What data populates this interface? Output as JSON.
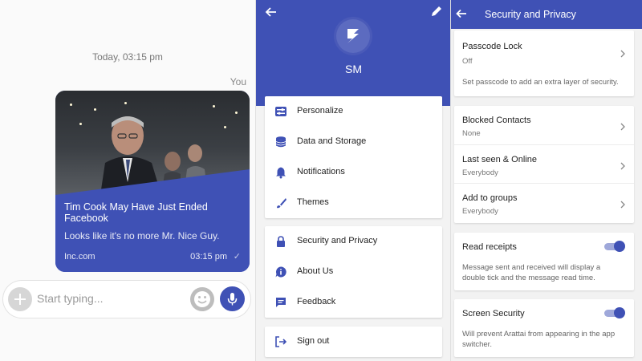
{
  "colors": {
    "accent": "#3f51b5"
  },
  "chat": {
    "date_label": "Today, 03:15 pm",
    "sender_label": "You",
    "link_card": {
      "title": "Tim Cook May Have Just Ended Facebook",
      "subtitle": "Looks like it's no more Mr. Nice Guy.",
      "source": "Inc.com",
      "time": "03:15 pm",
      "status_icon": "check-icon"
    },
    "composer": {
      "placeholder": "Start typing...",
      "add_icon": "plus-icon",
      "emoji_icon": "emoji-icon",
      "mic_icon": "mic-icon"
    }
  },
  "menu": {
    "profile_name": "SM",
    "header_icons": [
      "back-arrow-icon",
      "pencil-icon"
    ],
    "group1": [
      {
        "label": "Personalize",
        "icon": "sliders-icon"
      },
      {
        "label": "Data and Storage",
        "icon": "database-icon"
      },
      {
        "label": "Notifications",
        "icon": "bell-icon"
      },
      {
        "label": "Themes",
        "icon": "brush-icon"
      }
    ],
    "group2": [
      {
        "label": "Security and Privacy",
        "icon": "lock-icon"
      },
      {
        "label": "About Us",
        "icon": "info-bubble-icon"
      },
      {
        "label": "Feedback",
        "icon": "feedback-icon"
      }
    ],
    "group3": [
      {
        "label": "Sign out",
        "icon": "sign-out-icon"
      }
    ]
  },
  "settings": {
    "title": "Security and Privacy",
    "passcode": {
      "title": "Passcode Lock",
      "value": "Off",
      "description": "Set passcode to add an extra layer of security."
    },
    "privacy": [
      {
        "title": "Blocked Contacts",
        "value": "None"
      },
      {
        "title": "Last seen & Online",
        "value": "Everybody"
      },
      {
        "title": "Add to groups",
        "value": "Everybody"
      }
    ],
    "read_receipts": {
      "title": "Read receipts",
      "enabled": true,
      "description": "Message sent and received will display a double tick and the message read time."
    },
    "screen_security": {
      "title": "Screen Security",
      "enabled": true,
      "description": "Will prevent Arattai from appearing in the app switcher."
    }
  }
}
